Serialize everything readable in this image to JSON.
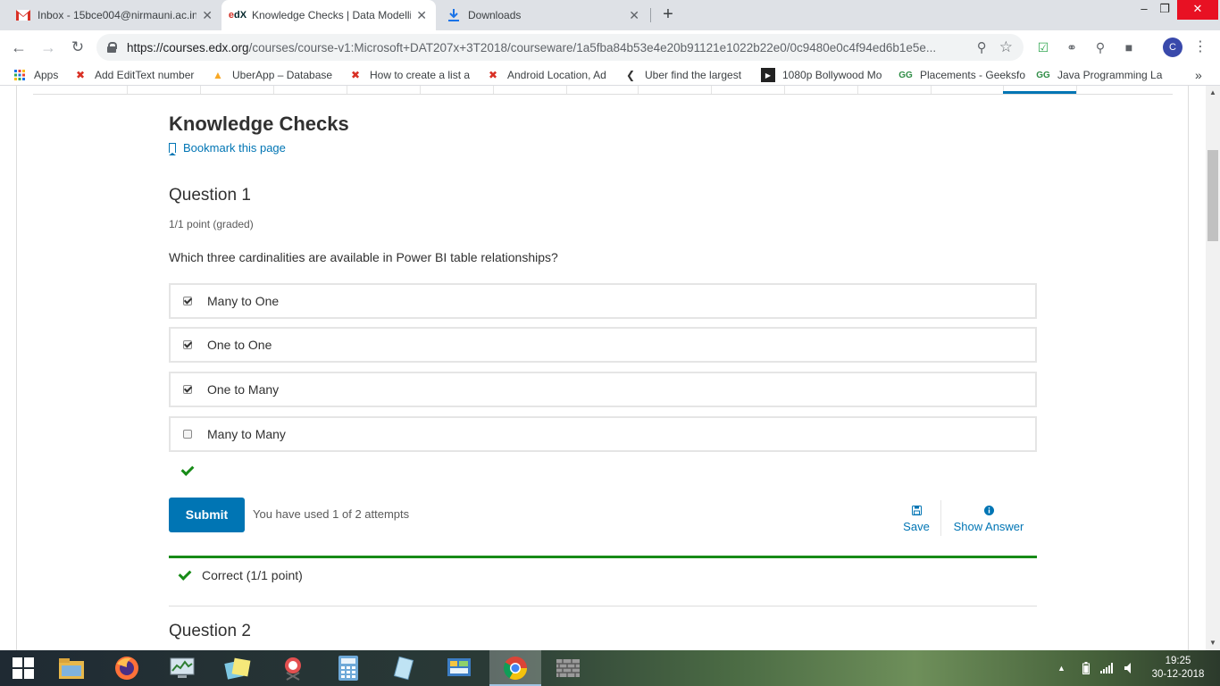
{
  "browser": {
    "tabs": [
      {
        "title": "Inbox - 15bce004@nirmauni.ac.in",
        "favicon": "gmail-icon",
        "active": false
      },
      {
        "title": "Knowledge Checks | Data Modelli",
        "favicon": "edx-icon",
        "active": true
      },
      {
        "title": "Downloads",
        "favicon": "download-icon",
        "active": false
      }
    ],
    "url_host": "https://courses.edx.org",
    "url_path": "/courses/course-v1:Microsoft+DAT207x+3T2018/courseware/1a5fba84b53e4e20b91121e1022b22e0/0c9480e0c4f94ed6b1e5e...",
    "profile_initial": "C",
    "bookmarks": [
      {
        "label": "Apps",
        "icon": "apps-grid-icon"
      },
      {
        "label": "Add EditText number",
        "icon": "bookmark-x-icon"
      },
      {
        "label": "UberApp – Database",
        "icon": "firebase-icon"
      },
      {
        "label": "How to create a list a",
        "icon": "bookmark-x-icon"
      },
      {
        "label": "Android Location, Ad",
        "icon": "bookmark-x-icon"
      },
      {
        "label": "Uber find the largest",
        "icon": "quora-icon"
      },
      {
        "label": "1080p Bollywood Mo",
        "icon": "play-icon"
      },
      {
        "label": "Placements - Geeksfo",
        "icon": "geeks-icon"
      },
      {
        "label": "Java Programming La",
        "icon": "geeks-icon"
      }
    ],
    "bookmarks_more": "»"
  },
  "page": {
    "title": "Knowledge Checks",
    "bookmark_link": "Bookmark this page",
    "question1": {
      "title": "Question 1",
      "points": "1/1 point (graded)",
      "prompt": "Which three cardinalities are available in Power BI table relationships?",
      "choices": [
        {
          "label": "Many to One",
          "checked": true
        },
        {
          "label": "One to One",
          "checked": true
        },
        {
          "label": "One to Many",
          "checked": true
        },
        {
          "label": "Many to Many",
          "checked": false
        }
      ],
      "submit_label": "Submit",
      "attempts_text": "You have used 1 of 2 attempts",
      "save_label": "Save",
      "show_answer_label": "Show Answer",
      "result_text": "Correct (1/1 point)"
    },
    "question2": {
      "title": "Question 2"
    }
  },
  "taskbar": {
    "time": "19:25",
    "date": "30-12-2018"
  },
  "colors": {
    "accent": "#0075b4",
    "correct": "#178b17"
  }
}
